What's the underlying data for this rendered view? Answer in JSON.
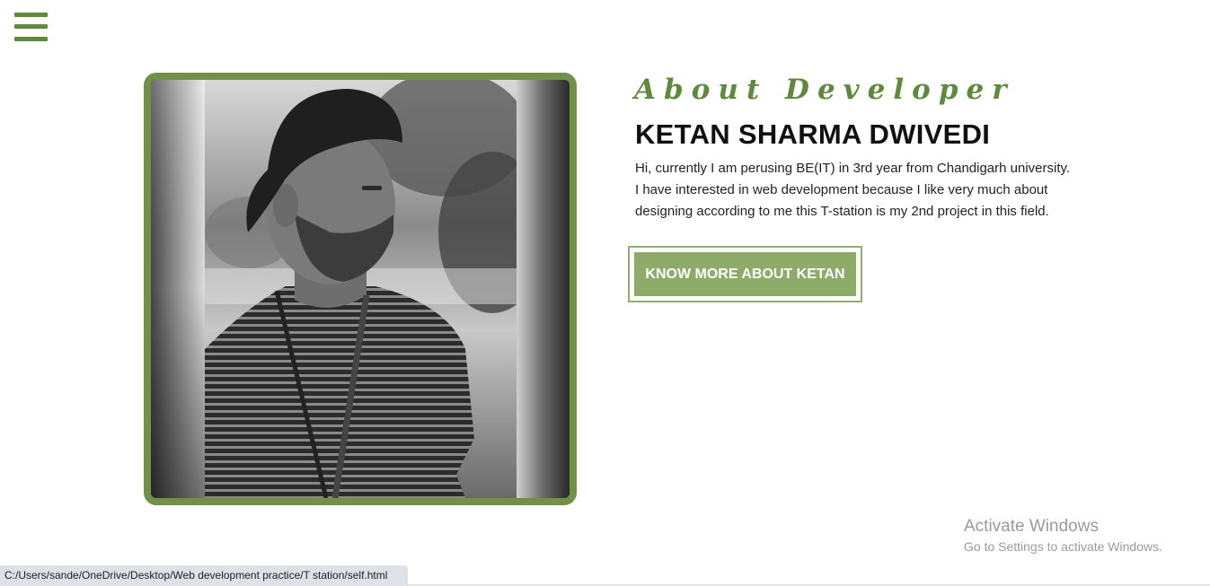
{
  "nav": {
    "menu_icon": "hamburger-menu-icon"
  },
  "about": {
    "heading": "About Developer",
    "name": "KETAN SHARMA DWIVEDI",
    "bio": "Hi, currently I am perusing BE(IT) in 3rd year from Chandigarh university. I have interested in web development because I like very much about designing according to me this T-station is my 2nd project in this field.",
    "cta_label": "KNOW MORE ABOUT KETAN"
  },
  "photo": {
    "alt": "Black and white portrait of developer",
    "frame_color": "#6f9148"
  },
  "watermark": {
    "title": "Activate Windows",
    "subtitle": "Go to Settings to activate Windows."
  },
  "statusbar": {
    "url": "C:/Users/sande/OneDrive/Desktop/Web development practice/T station/self.html"
  },
  "colors": {
    "accent": "#5f8a3c",
    "button": "#8eac69",
    "button_border": "#8fae70"
  }
}
